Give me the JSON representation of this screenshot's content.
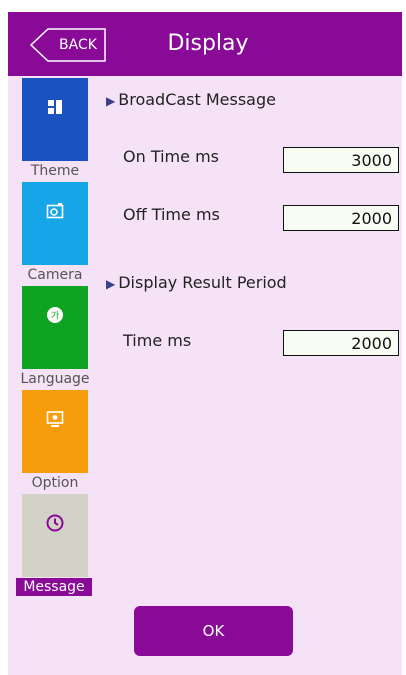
{
  "header": {
    "back_label": "BACK",
    "title": "Display"
  },
  "sidebar": {
    "items": [
      {
        "label": "Theme",
        "icon": "theme-icon",
        "color": "#1b52c2",
        "active": false
      },
      {
        "label": "Camera",
        "icon": "camera-icon",
        "color": "#16a5e6",
        "active": false
      },
      {
        "label": "Language",
        "icon": "language-icon",
        "color": "#0ea320",
        "active": false
      },
      {
        "label": "Option",
        "icon": "option-icon",
        "color": "#f59d0a",
        "active": false
      },
      {
        "label": "Message",
        "icon": "clock-icon",
        "color": "#d3d2c6",
        "active": true
      }
    ]
  },
  "main": {
    "broadcast": {
      "title": "BroadCast Message",
      "on_time_label": "On Time ms",
      "on_time_value": "3000",
      "off_time_label": "Off Time ms",
      "off_time_value": "2000"
    },
    "result": {
      "title": "Display Result Period",
      "time_label": "Time ms",
      "time_value": "2000"
    }
  },
  "footer": {
    "ok_label": "OK"
  },
  "colors": {
    "accent": "#8a0a98",
    "background": "#f6e2f6"
  }
}
